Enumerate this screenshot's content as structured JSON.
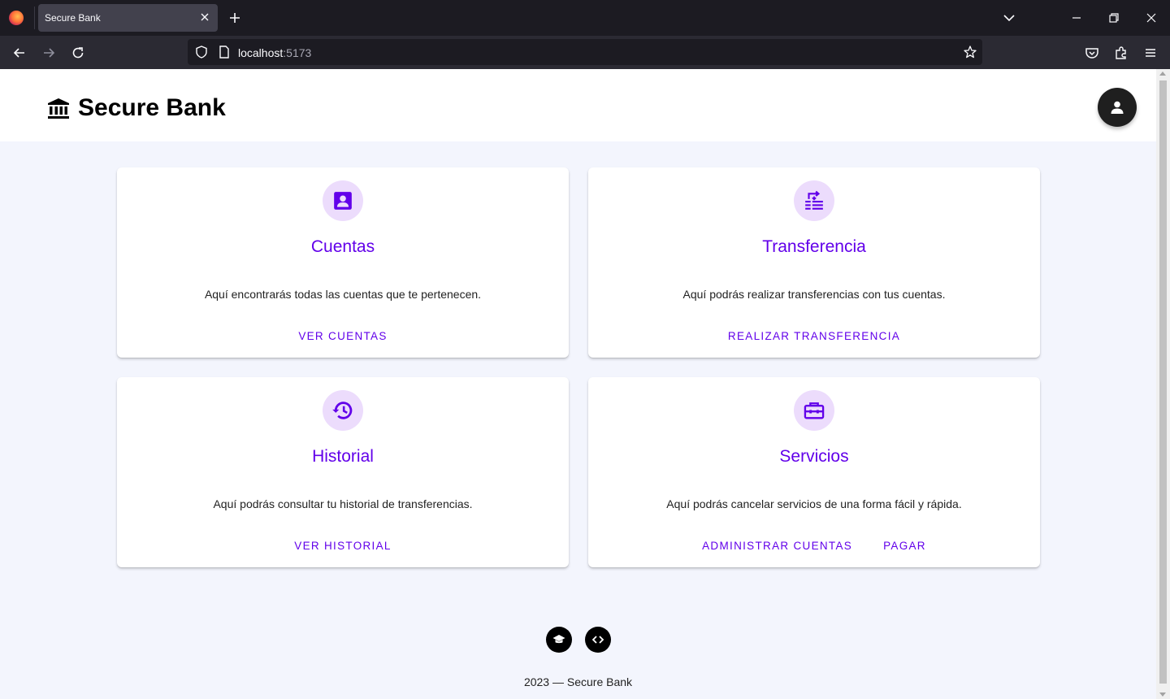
{
  "browser": {
    "tab_title": "Secure Bank",
    "url_host": "localhost",
    "url_port": ":5173"
  },
  "app": {
    "brand_name": "Secure Bank"
  },
  "cards": [
    {
      "title": "Cuentas",
      "description": "Aquí encontrarás todas las cuentas que te pertenecen.",
      "icon": "account-box-icon",
      "actions": [
        "VER CUENTAS"
      ]
    },
    {
      "title": "Transferencia",
      "description": "Aquí podrás realizar transferencias con tus cuentas.",
      "icon": "transfer-icon",
      "actions": [
        "REALIZAR TRANSFERENCIA"
      ]
    },
    {
      "title": "Historial",
      "description": "Aquí podrás consultar tu historial de transferencias.",
      "icon": "history-icon",
      "actions": [
        "VER HISTORIAL"
      ]
    },
    {
      "title": "Servicios",
      "description": "Aquí podrás cancelar servicios de una forma fácil y rápida.",
      "icon": "briefcase-icon",
      "actions": [
        "ADMINISTRAR CUENTAS",
        "PAGAR"
      ]
    }
  ],
  "footer": {
    "text": "2023 — Secure Bank",
    "icons": [
      "school-icon",
      "code-icon"
    ]
  },
  "colors": {
    "accent": "#6200ea",
    "icon_bg": "#ecdcfc",
    "page_bg": "#f3f5fd"
  }
}
